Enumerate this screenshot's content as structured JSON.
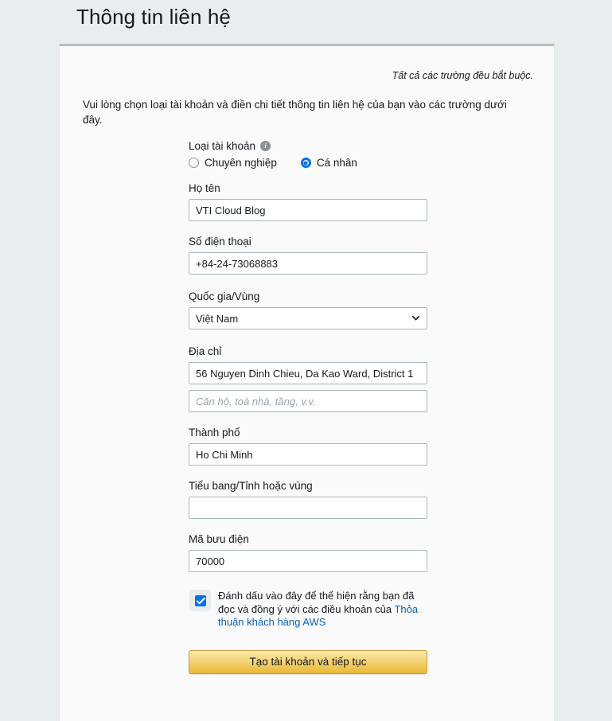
{
  "page": {
    "title": "Thông tin liên hệ",
    "required_note": "Tất cả các trường đều bắt buộc.",
    "intro": "Vui lòng chọn loại tài khoản và điền chi tiết thông tin liên hệ của bạn vào các trường dưới đây."
  },
  "form": {
    "account_type": {
      "label": "Loại tài khoản",
      "info_icon": "info-icon",
      "info_glyph": "i",
      "options": [
        {
          "label": "Chuyên nghiệp",
          "selected": false
        },
        {
          "label": "Cá nhân",
          "selected": true
        }
      ]
    },
    "full_name": {
      "label": "Họ tên",
      "value": "VTI Cloud Blog",
      "placeholder": ""
    },
    "phone": {
      "label": "Số điện thoại",
      "value": "+84-24-73068883",
      "placeholder": ""
    },
    "country": {
      "label": "Quốc gia/Vùng",
      "value": "Việt Nam",
      "chevron_icon": "chevron-down-icon"
    },
    "address": {
      "label": "Địa chỉ",
      "line1_value": "56 Nguyen Dinh Chieu, Da Kao Ward, District 1",
      "line2_value": "",
      "line2_placeholder": "Căn hộ, toà nhà, tầng, v.v."
    },
    "city": {
      "label": "Thành phố",
      "value": "Ho Chi Minh",
      "placeholder": ""
    },
    "state": {
      "label": "Tiểu bang/Tỉnh hoặc vùng",
      "value": "",
      "placeholder": ""
    },
    "postal_code": {
      "label": "Mã bưu điện",
      "value": "70000",
      "placeholder": ""
    },
    "agreement": {
      "checked": true,
      "check_icon": "checkmark-icon",
      "text": "Đánh dấu vào đây để thể hiện rằng bạn đã đọc và đồng ý với các điều khoản của ",
      "link_text": "Thỏa thuận khách hàng AWS"
    },
    "submit_label": "Tạo tài khoản và tiếp tục"
  },
  "colors": {
    "page_background": "#eaeded",
    "card_background": "#fafafa",
    "accent_blue": "#0073e6",
    "link_blue": "#0a62b6",
    "button_gold": "#eec24a",
    "text": "#16191f"
  }
}
